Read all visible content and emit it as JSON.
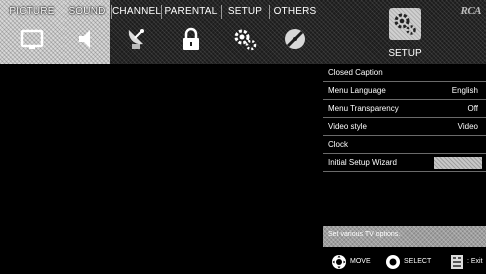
{
  "tabs": [
    {
      "label": "PICTURE",
      "icon": "tv-icon",
      "highlighted": true
    },
    {
      "label": "SOUND",
      "icon": "speaker-icon",
      "highlighted": true
    },
    {
      "label": "CHANNEL",
      "icon": "satellite-dish-icon",
      "highlighted": false
    },
    {
      "label": "PARENTAL",
      "icon": "padlock-icon",
      "highlighted": false
    },
    {
      "label": "SETUP",
      "icon": "gears-icon",
      "highlighted": false
    },
    {
      "label": "OTHERS",
      "icon": "disc-icon",
      "highlighted": false
    }
  ],
  "header": {
    "active_section": "SETUP",
    "active_icon": "gears-icon",
    "brand": "RCA"
  },
  "menu": {
    "items": [
      {
        "label": "Closed Caption",
        "value": ""
      },
      {
        "label": "Menu Language",
        "value": "English"
      },
      {
        "label": "Menu Transparency",
        "value": "Off"
      },
      {
        "label": "Video style",
        "value": "Video"
      },
      {
        "label": "Clock",
        "value": ""
      },
      {
        "label": "Initial Setup Wizard",
        "value": "",
        "selected": true
      }
    ],
    "selected_button": "",
    "help_text": "Set various TV options."
  },
  "footer": {
    "move_label": "MOVE",
    "move_icon": "dpad-icon",
    "select_label": "SELECT",
    "select_icon": "ok-button-icon",
    "exit_label": ": Exit",
    "exit_icon": "remote-exit-icon"
  },
  "colors": {
    "background": "#000000",
    "menubar": "#1c1c1c",
    "highlight": "#c8c8c8",
    "text": "#ffffff",
    "divider": "#6a6a6a"
  }
}
